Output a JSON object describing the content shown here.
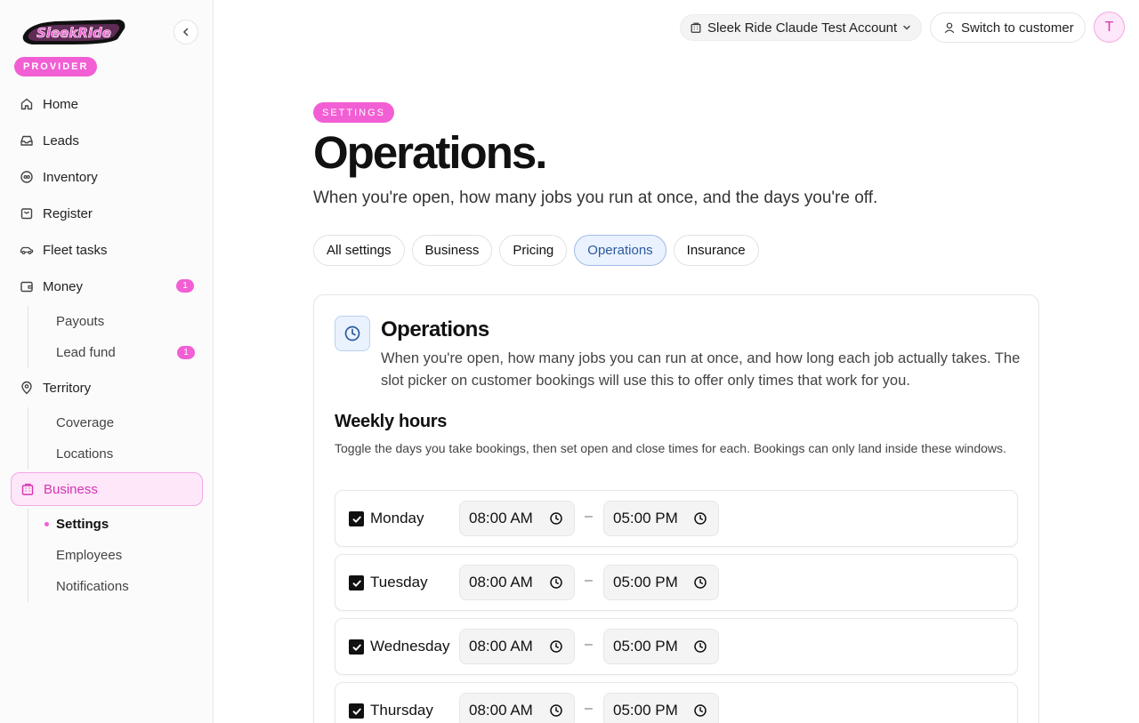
{
  "sidebar": {
    "logo_text": "SleekRide",
    "badge": "PROVIDER",
    "nav": [
      {
        "label": "Home"
      },
      {
        "label": "Leads"
      },
      {
        "label": "Inventory"
      },
      {
        "label": "Register"
      },
      {
        "label": "Fleet tasks"
      },
      {
        "label": "Money",
        "count": "1"
      }
    ],
    "money_sub": [
      {
        "label": "Payouts"
      },
      {
        "label": "Lead fund",
        "count": "1"
      }
    ],
    "territory": {
      "label": "Territory"
    },
    "territory_sub": [
      {
        "label": "Coverage"
      },
      {
        "label": "Locations"
      }
    ],
    "business": {
      "label": "Business"
    },
    "business_sub": [
      {
        "label": "Settings"
      },
      {
        "label": "Employees"
      },
      {
        "label": "Notifications"
      }
    ]
  },
  "topbar": {
    "account": "Sleek Ride Claude Test Account",
    "switch_label": "Switch to customer",
    "avatar_initial": "T"
  },
  "page": {
    "tag": "SETTINGS",
    "title": "Operations.",
    "subtitle": "When you're open, how many jobs you run at once, and the days you're off."
  },
  "tabs": [
    {
      "label": "All settings"
    },
    {
      "label": "Business"
    },
    {
      "label": "Pricing"
    },
    {
      "label": "Operations"
    },
    {
      "label": "Insurance"
    }
  ],
  "card": {
    "title": "Operations",
    "description": "When you're open, how many jobs you can run at once, and how long each job actually takes. The slot picker on customer bookings will use this to offer only times that work for you.",
    "weekly_hours_title": "Weekly hours",
    "weekly_hours_desc": "Toggle the days you take bookings, then set open and close times for each. Bookings can only land inside these windows.",
    "separator": "–",
    "days": [
      {
        "name": "Monday",
        "open": "08:00 AM",
        "close": "05:00 PM"
      },
      {
        "name": "Tuesday",
        "open": "08:00 AM",
        "close": "05:00 PM"
      },
      {
        "name": "Wednesday",
        "open": "08:00 AM",
        "close": "05:00 PM"
      },
      {
        "name": "Thursday",
        "open": "08:00 AM",
        "close": "05:00 PM"
      }
    ]
  },
  "colors": {
    "accent_pink": "#f25fd4",
    "accent_blue": "#2c5a9e"
  }
}
